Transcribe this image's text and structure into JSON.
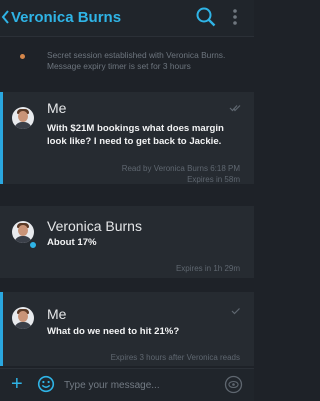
{
  "header": {
    "title": "Veronica Burns",
    "back_icon": "chevron-left-icon",
    "search_icon": "search-icon",
    "menu_icon": "overflow-menu-icon",
    "accent_color": "#2fb4e6"
  },
  "system_message": {
    "line1": "Secret session established with Veronica Burns.",
    "line2": "Message expiry timer is set for 3 hours",
    "dot_color": "#d5864a"
  },
  "messages": [
    {
      "sender": "Me",
      "body": "With $21M bookings what does margin look like? I need to get back to Jackie.",
      "meta_line1": "Read by Veronica Burns 6:18 PM",
      "meta_line2": "Expires in 58m",
      "status_icon": "double-check-icon"
    },
    {
      "sender": "Veronica Burns",
      "body": "About 17%",
      "meta_line1": "Expires in 1h 29m"
    },
    {
      "sender": "Me",
      "body": "What do we need to hit 21%?",
      "meta_line1": "Expires 3 hours after Veronica reads",
      "status_icon": "check-icon"
    }
  ],
  "composer": {
    "placeholder": "Type your message...",
    "add_icon": "plus-icon",
    "emoji_icon": "emoji-icon",
    "send_icon": "send-icon"
  }
}
